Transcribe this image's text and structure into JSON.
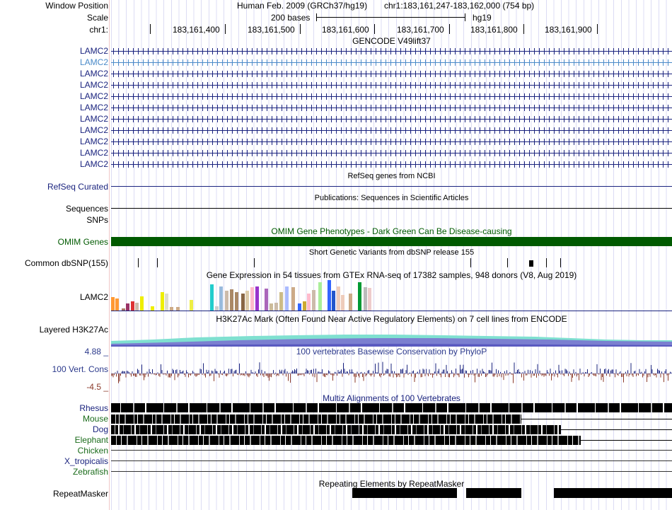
{
  "header": {
    "window_position_label": "Window Position",
    "scale_label": "Scale",
    "chrom_label": "chr1:",
    "assembly": "Human Feb. 2009 (GRCh37/hg19)",
    "position": "chr1:183,161,247-183,162,000 (754 bp)",
    "scale_text": "200 bases",
    "db": "hg19",
    "ruler_ticks": [
      "183,161,400",
      "183,161,500",
      "183,161,600",
      "183,161,700",
      "183,161,800",
      "183,161,900"
    ]
  },
  "gencode": {
    "title": "GENCODE V49lift37",
    "transcripts": [
      "LAMC2",
      "LAMC2",
      "LAMC2",
      "LAMC2",
      "LAMC2",
      "LAMC2",
      "LAMC2",
      "LAMC2",
      "LAMC2",
      "LAMC2"
    ],
    "last_transcript": "LAMC2"
  },
  "refseq": {
    "title": "RefSeq genes from NCBI",
    "label": "RefSeq Curated"
  },
  "publications": {
    "title": "Publications: Sequences in Scientific Articles",
    "label1": "Sequences",
    "label2": "SNPs"
  },
  "omim": {
    "title": "OMIM Gene Phenotypes - Dark Green Can Be Disease-causing",
    "label": "OMIM Genes",
    "color": "#005a00"
  },
  "dbsnp": {
    "title": "Short Genetic Variants from dbSNP release 155",
    "label": "Common dbSNP(155)"
  },
  "gtex": {
    "title": "Gene Expression in 54 tissues from GTEx RNA-seq of 17382 samples, 948 donors (V8, Aug 2019)",
    "label": "LAMC2",
    "levels": [
      0.43,
      0.38,
      0.07,
      0.22,
      0.3,
      0.24,
      0.45,
      0.13,
      0.6,
      0.55,
      0.11,
      0.11,
      0.33,
      0.83,
      0.13,
      0.78,
      0.64,
      0.68,
      0.6,
      0.55,
      0.64,
      0.75,
      0.78,
      0.7,
      0.23,
      0.25,
      0.6,
      0.78,
      0.75,
      0.22,
      0.3,
      0.55,
      0.67,
      0.92,
      0.98,
      0.63,
      0.78,
      0.5,
      0.55,
      0.9,
      0.75,
      0.73
    ]
  },
  "h3k27ac": {
    "title": "H3K27Ac Mark (Often Found Near Active Regulatory Elements) on 7 cell lines from ENCODE",
    "label": "Layered H3K27Ac"
  },
  "phylop": {
    "title": "100 vertebrates Basewise Conservation by PhyloP",
    "label": "100 Vert. Cons",
    "ymax": "4.88 _",
    "ymin": "-4.5 _"
  },
  "multiz": {
    "title": "Multiz Alignments of 100 Vertebrates",
    "species": [
      "Rhesus",
      "Mouse",
      "Dog",
      "Elephant",
      "Chicken",
      "X_tropicalis",
      "Zebrafish"
    ]
  },
  "repeatmasker": {
    "title": "Repeating Elements by RepeatMasker",
    "label": "RepeatMasker"
  }
}
